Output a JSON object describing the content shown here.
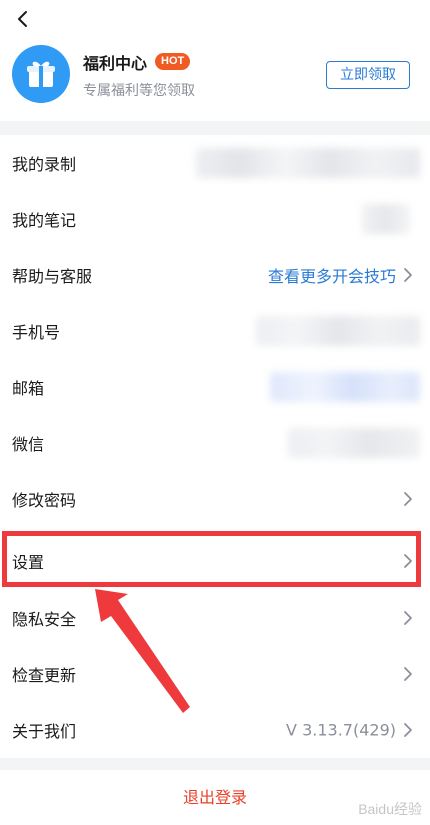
{
  "header": {
    "back_icon": "chevron-left-icon"
  },
  "benefit": {
    "icon": "gift-icon",
    "title": "福利中心",
    "badge": "HOT",
    "subtitle": "专属福利等您领取",
    "claim_label": "立即领取",
    "accent_color": "#2a7bd6",
    "badge_color": "#f05a23"
  },
  "menu": {
    "items": [
      {
        "label": "我的录制",
        "value": "",
        "redacted": true
      },
      {
        "label": "我的笔记",
        "value": "",
        "redacted": true
      },
      {
        "label": "帮助与客服",
        "value": "查看更多开会技巧"
      },
      {
        "label": "手机号",
        "value": "",
        "redacted": true
      },
      {
        "label": "邮箱",
        "value": "",
        "redacted": true
      },
      {
        "label": "微信",
        "value": "",
        "redacted": true
      },
      {
        "label": "修改密码",
        "value": ""
      },
      {
        "label": "设置",
        "value": "",
        "highlighted": true
      },
      {
        "label": "隐私安全",
        "value": ""
      },
      {
        "label": "检查更新",
        "value": ""
      },
      {
        "label": "关于我们",
        "value": "V 3.13.7(429)"
      }
    ]
  },
  "logout": {
    "label": "退出登录",
    "color": "#e8402a"
  },
  "annotation": {
    "highlight_color": "#ee3a3c"
  },
  "watermark": {
    "text": "Baidu经验"
  }
}
